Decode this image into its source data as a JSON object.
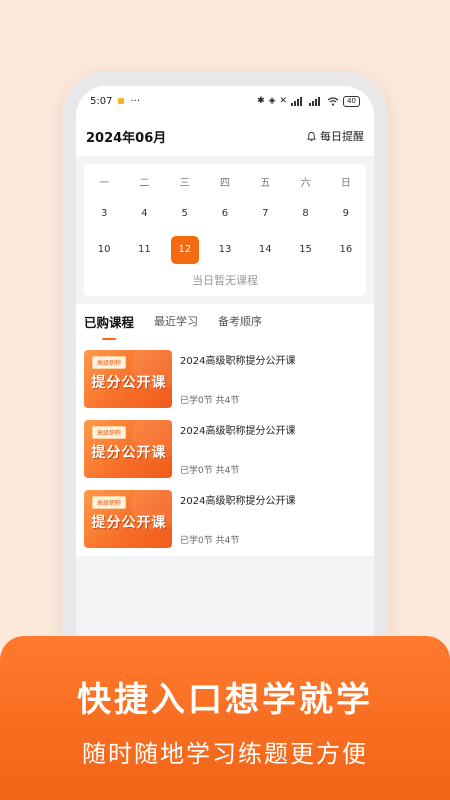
{
  "status": {
    "time": "5:07",
    "menu": "···",
    "battery": "40"
  },
  "header": {
    "month": "2024年06月",
    "remind": "每日提醒"
  },
  "calendar": {
    "weekdays": [
      "一",
      "二",
      "三",
      "四",
      "五",
      "六",
      "日"
    ],
    "row1": [
      "3",
      "4",
      "5",
      "6",
      "7",
      "8",
      "9"
    ],
    "row2": [
      "10",
      "11",
      "12",
      "13",
      "14",
      "15",
      "16"
    ],
    "selected": "12",
    "empty_text": "当日暂无课程"
  },
  "tabs": [
    "已购课程",
    "最近学习",
    "备考顺序"
  ],
  "courses": [
    {
      "tag": "高级职称",
      "thumb_title": "提分公开课",
      "title": "2024高级职称提分公开课",
      "progress": "已学0节 共4节"
    },
    {
      "tag": "高级职称",
      "thumb_title": "提分公开课",
      "title": "2024高级职称提分公开课",
      "progress": "已学0节 共4节"
    },
    {
      "tag": "高级职称",
      "thumb_title": "提分公开课",
      "title": "2024高级职称提分公开课",
      "progress": "已学0节 共4节"
    }
  ],
  "banner": {
    "title": "快捷入口想学就学",
    "subtitle": "随时随地学习练题更方便"
  },
  "colors": {
    "accent": "#f46a12",
    "background": "#fbe9dc"
  }
}
